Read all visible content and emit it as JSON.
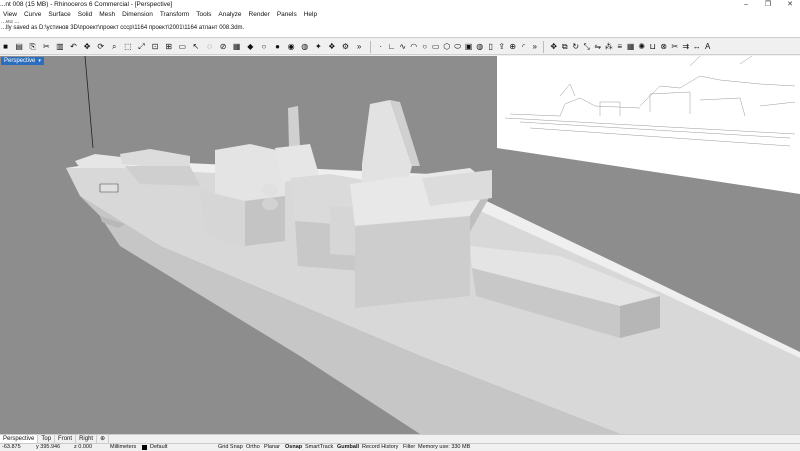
{
  "window": {
    "title": "...nt 008 (15 MB) - Rhinoceros 6 Commercial - [Perspective]",
    "controls": {
      "minimize": "–",
      "maximize": "❐",
      "close": "✕"
    }
  },
  "menu": {
    "items": [
      "View",
      "Curve",
      "Surface",
      "Solid",
      "Mesh",
      "Dimension",
      "Transform",
      "Tools",
      "Analyze",
      "Render",
      "Panels",
      "Help"
    ]
  },
  "command_history": {
    "line1": "...ed ...",
    "line2": "...lly saved as D:\\устинов 3D\\проект\\проект ссср\\1164 проект\\2001\\1164 атлант 008.3dm."
  },
  "toolbar": {
    "icons": [
      "save-icon",
      "print-icon",
      "copy-icon",
      "cut-icon",
      "clipboard-icon",
      "undo-icon",
      "pan-icon",
      "rotate-view-icon",
      "zoom-icon",
      "zoom-window-icon",
      "zoom-extents-icon",
      "zoom-selected-icon",
      "viewport-4-icon",
      "cplane-icon",
      "select-icon",
      "hide-icon",
      "lock-icon",
      "layer-icon",
      "color-icon",
      "wireframe-icon",
      "shaded-icon",
      "rendered-icon",
      "material-icon",
      "light-icon",
      "render-icon",
      "options-icon",
      "more-icon",
      "point-icon",
      "polyline-icon",
      "curve-icon",
      "arc-icon",
      "circle-icon",
      "rectangle-icon",
      "polygon-icon",
      "ellipse-icon",
      "box-icon",
      "sphere-icon",
      "cylinder-icon",
      "extrude-icon",
      "boolean-icon",
      "fillet-icon",
      "more-icon",
      "move-icon",
      "copy-object-icon",
      "rotate-icon",
      "scale-icon",
      "mirror-icon",
      "array-icon",
      "align-icon",
      "group-icon",
      "explode-icon",
      "join-icon",
      "split-icon",
      "trim-icon",
      "offset-icon",
      "dimension-icon",
      "text-icon"
    ],
    "glyphs": [
      "■",
      "▤",
      "⎘",
      "✂",
      "▥",
      "↶",
      "✥",
      "⟳",
      "⌕",
      "⬚",
      "⤢",
      "⊡",
      "⊞",
      "▭",
      "↖",
      "◌",
      "⊘",
      "▦",
      "◆",
      "○",
      "●",
      "◉",
      "◍",
      "✦",
      "❖",
      "⚙",
      "»",
      "·",
      "∟",
      "∿",
      "◠",
      "○",
      "▭",
      "⬡",
      "⬭",
      "▣",
      "◍",
      "▯",
      "⇪",
      "⊕",
      "◜",
      "»",
      "✥",
      "⧉",
      "↻",
      "⤡",
      "⇋",
      "⁂",
      "≡",
      "▦",
      "✺",
      "⊔",
      "⊗",
      "✂",
      "⇉",
      "↔",
      "A"
    ]
  },
  "viewport": {
    "label": "Perspective",
    "menu_caret": "▾"
  },
  "viewport_tabs": [
    "Perspective",
    "Top",
    "Front",
    "Right",
    "⊕"
  ],
  "status_bar": {
    "x": "-63.875",
    "y": "y 395.946",
    "z": "z 0.000",
    "units": "Millimeters",
    "layer": "Default",
    "toggles": [
      "Grid Snap",
      "Ortho",
      "Planar",
      "Osnap",
      "SmartTrack",
      "Gumball",
      "Record History",
      "Filter"
    ],
    "memory": "Memory use: 330 MB"
  },
  "colors": {
    "viewport_background": "#8d8d8d",
    "model_light": "#e9e9e9",
    "model_mid": "#cfcfcf",
    "model_dark": "#b0b0b0",
    "active_tab": "#2a6ebd"
  }
}
